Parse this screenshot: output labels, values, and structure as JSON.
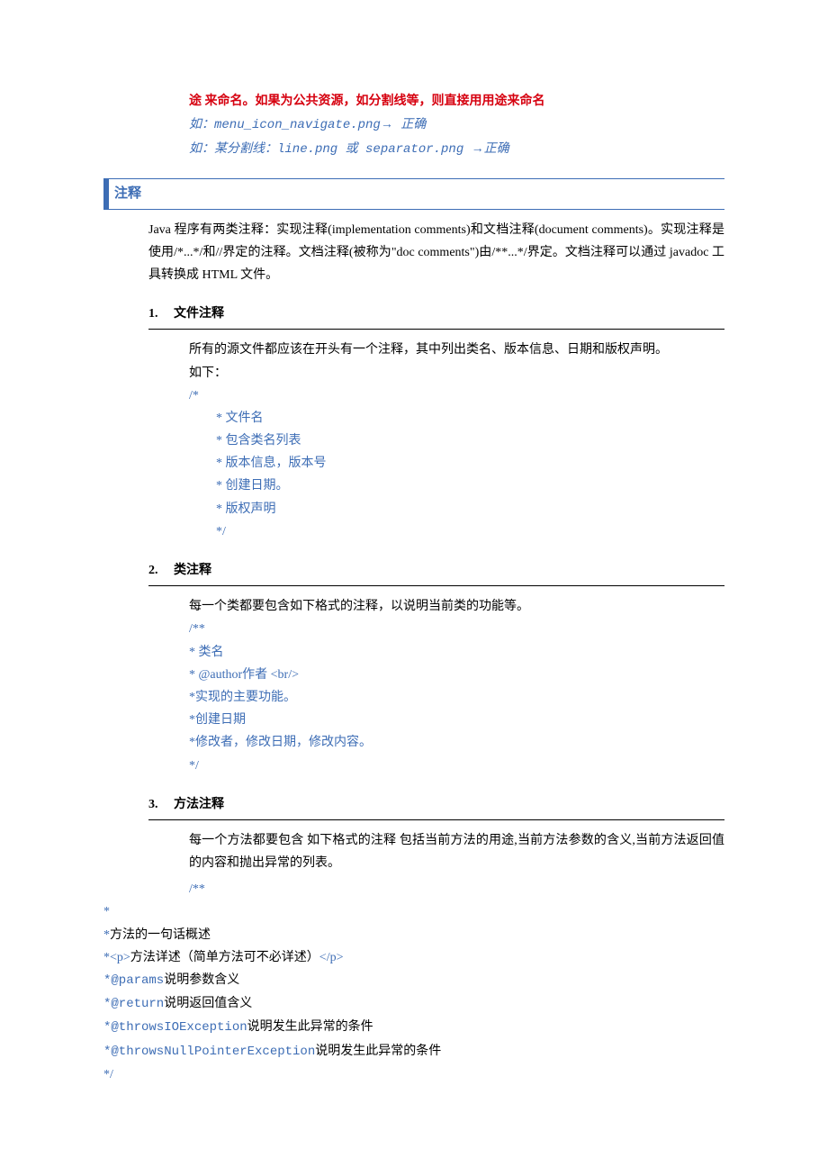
{
  "top": {
    "red_line": "途 来命名。如果为公共资源，如分割线等，则直接用用途来命名",
    "blue_line1_a": "如：menu_icon_navigate.png",
    "blue_line1_b": " 正确",
    "blue_line2_a": "如：某分割线：line.png  或 separator.png ",
    "blue_line2_b": "正确"
  },
  "section": {
    "title": "注释",
    "intro": "Java 程序有两类注释：实现注释(implementation comments)和文档注释(document comments)。实现注释是使用/*...*/和//界定的注释。文档注释(被称为\"doc comments\")由/**...*/界定。文档注释可以通过 javadoc 工具转换成 HTML 文件。"
  },
  "sub1": {
    "num": "1.",
    "title": "文件注释",
    "desc1": "所有的源文件都应该在开头有一个注释，其中列出类名、版本信息、日期和版权声明。",
    "desc2": "如下：",
    "c0": "/*",
    "c1": "* 文件名",
    "c2": "* 包含类名列表",
    "c3": "* 版本信息，版本号",
    "c4": "* 创建日期。",
    "c5": "* 版权声明",
    "c6": "*/"
  },
  "sub2": {
    "num": "2.",
    "title": "类注释",
    "desc": "每一个类都要包含如下格式的注释，以说明当前类的功能等。",
    "c0": "/**",
    "c1": " * 类名",
    "c2": " * @author作者 <br/>",
    "c3": " *实现的主要功能。",
    "c4": " *创建日期",
    "c5": " *修改者，修改日期，修改内容。",
    "c6": "*/"
  },
  "sub3": {
    "num": "3.",
    "title": "方法注释",
    "desc": "每一个方法都要包含 如下格式的注释 包括当前方法的用途,当前方法参数的含义,当前方法返回值的内容和抛出异常的列表。",
    "c0": "/**",
    "c1": "*",
    "c2a": "*",
    "c2b": "方法的一句话概述",
    "c3a": "*<p>",
    "c3b": "方法详述（简单方法可不必详述）",
    "c3c": "</p>",
    "c4a": "*@params",
    "c4b": "说明参数含义",
    "c5a": "*@return",
    "c5b": "说明返回值含义",
    "c6a": "*@throwsIOException",
    "c6b": "说明发生此异常的条件",
    "c7a": "*@throwsNullPointerException",
    "c7b": "说明发生此异常的条件",
    "c8": "*/"
  }
}
